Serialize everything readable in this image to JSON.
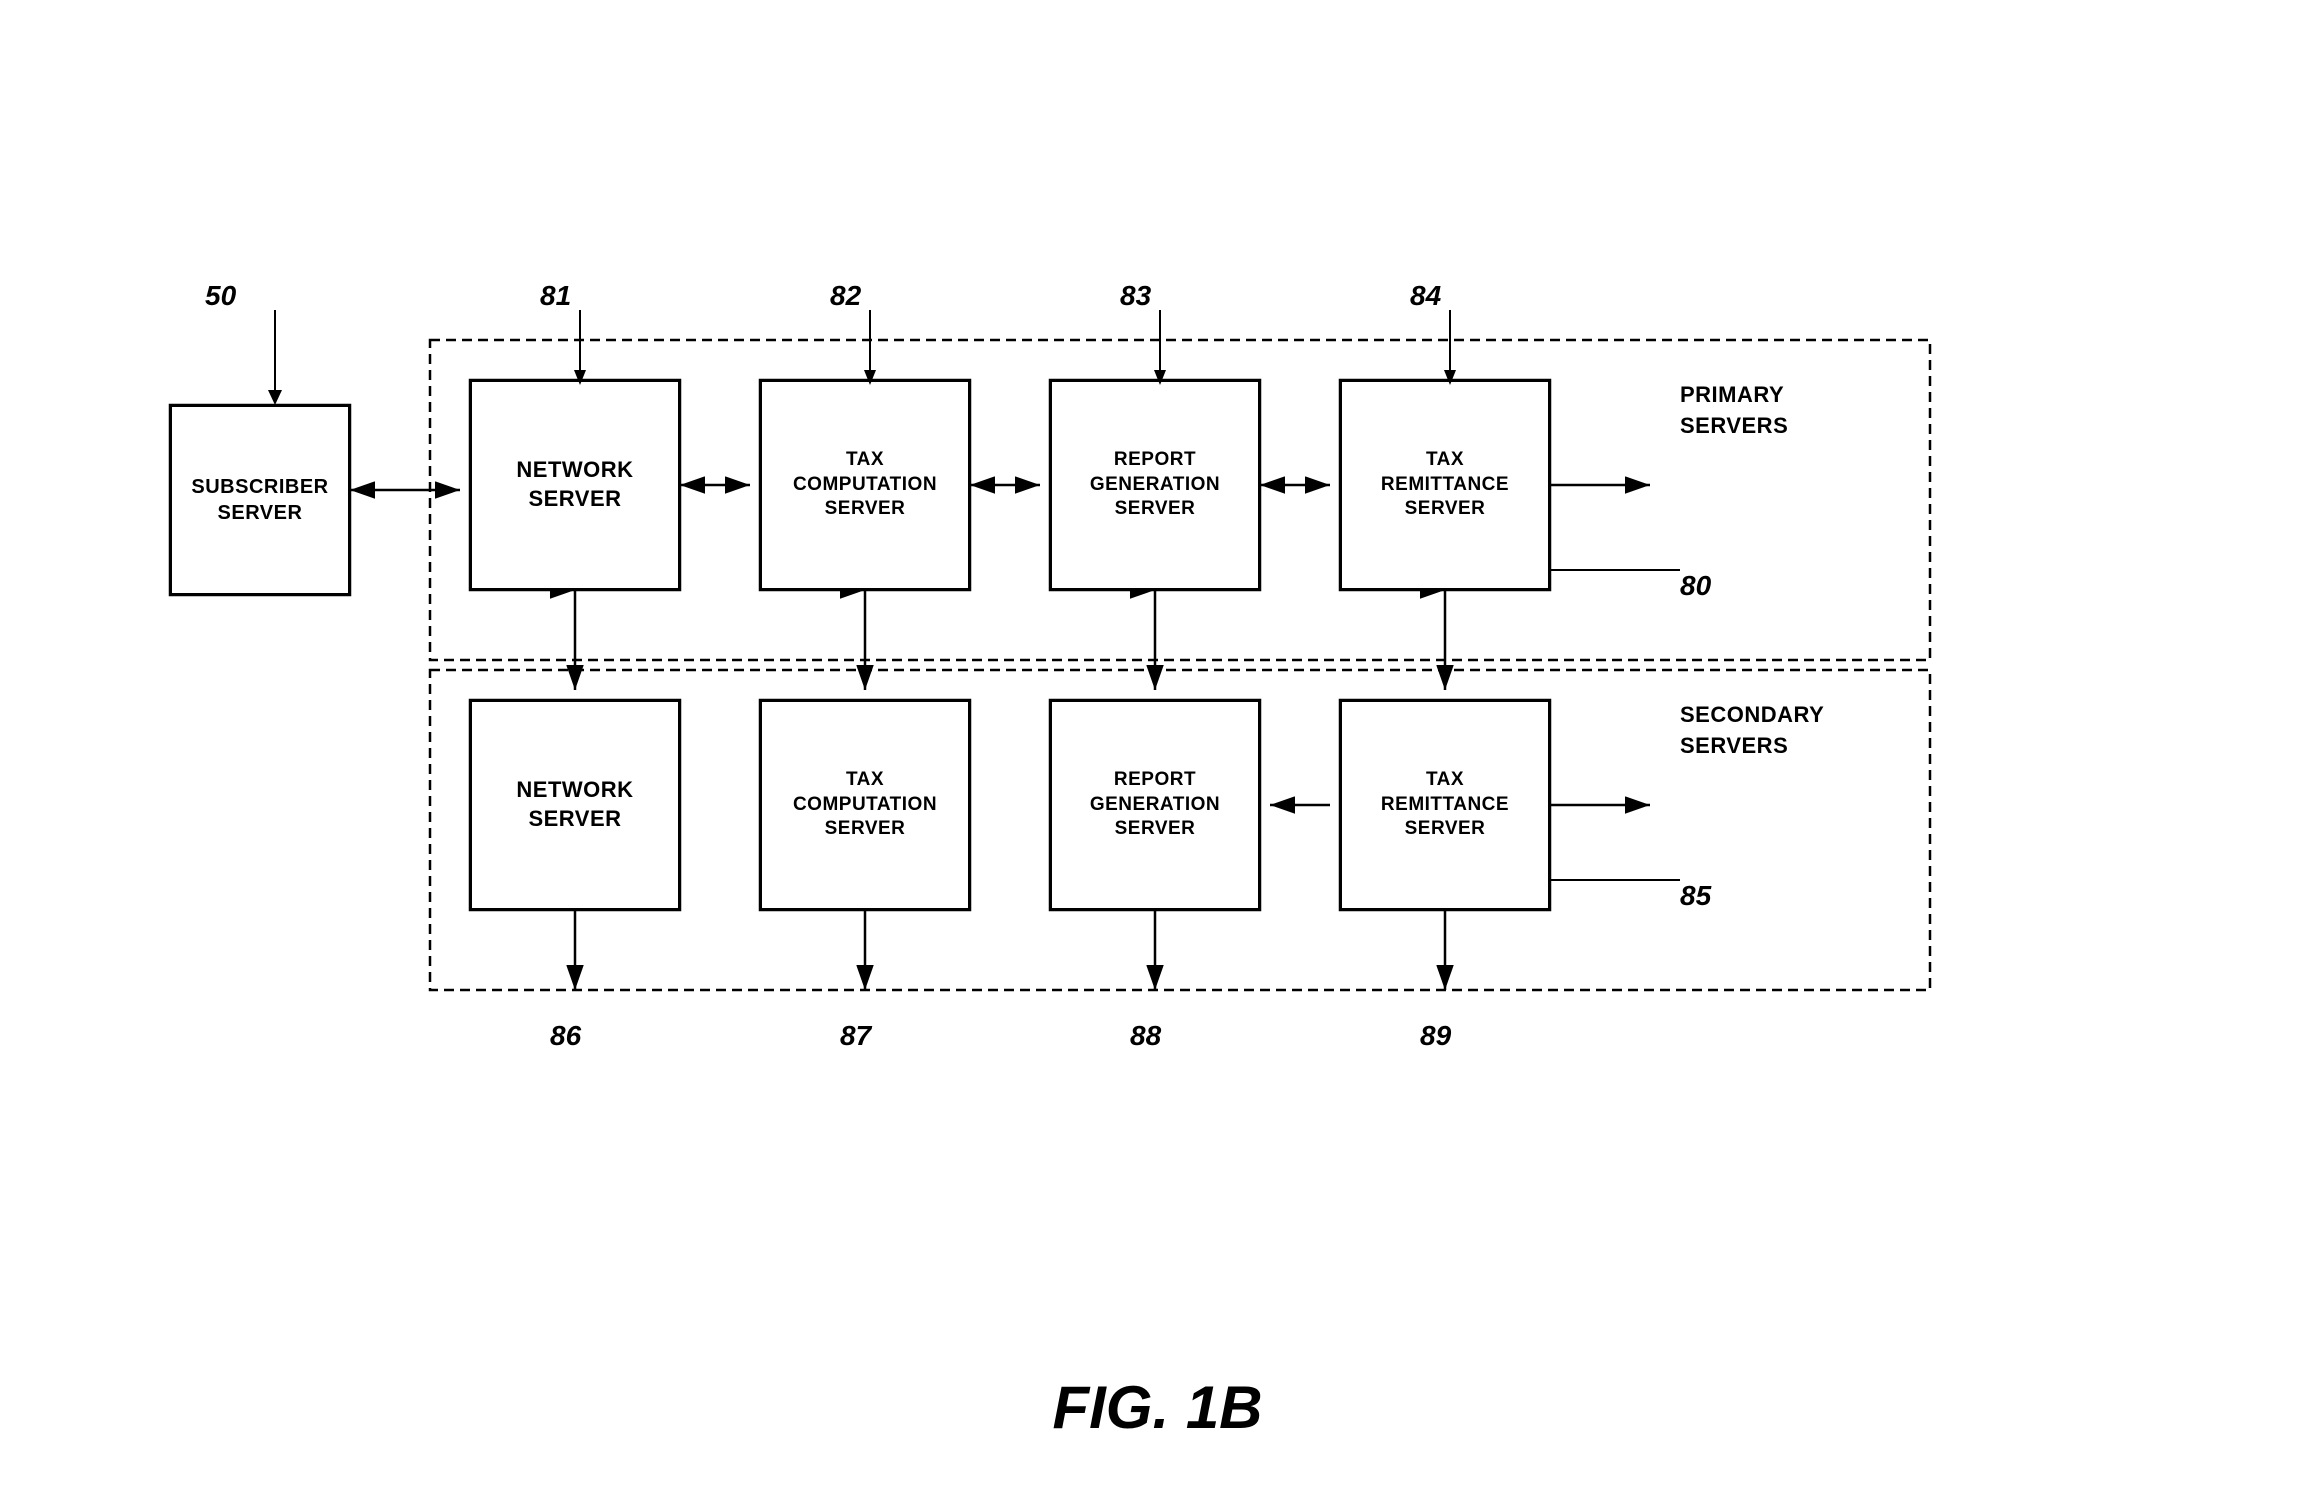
{
  "title": "FIG. 1B",
  "refs": {
    "r50": "50",
    "r80": "80",
    "r81": "81",
    "r82": "82",
    "r83": "83",
    "r84": "84",
    "r85": "85",
    "r86": "86",
    "r87": "87",
    "r88": "88",
    "r89": "89"
  },
  "boxes": {
    "subscriber": "SUBSCRIBER\nSERVER",
    "network_primary": "NETWORK\nSERVER",
    "tax_comp_primary": "TAX\nCOMPUTATION\nSERVER",
    "report_gen_primary": "REPORT\nGENERATION\nSERVER",
    "tax_rem_primary": "TAX\nREMITTANCE\nSERVER",
    "network_secondary": "NETWORK\nSERVER",
    "tax_comp_secondary": "TAX\nCOMPUTATION\nSERVER",
    "report_gen_secondary": "REPORT\nGENERATION\nSERVER",
    "tax_rem_secondary": "TAX\nREMITTANCE\nSERVER"
  },
  "labels": {
    "primary_servers": "PRIMARY\nSERVERS",
    "secondary_servers": "SECONDARY\nSERVERS"
  },
  "figureTitle": "FIG. 1B"
}
